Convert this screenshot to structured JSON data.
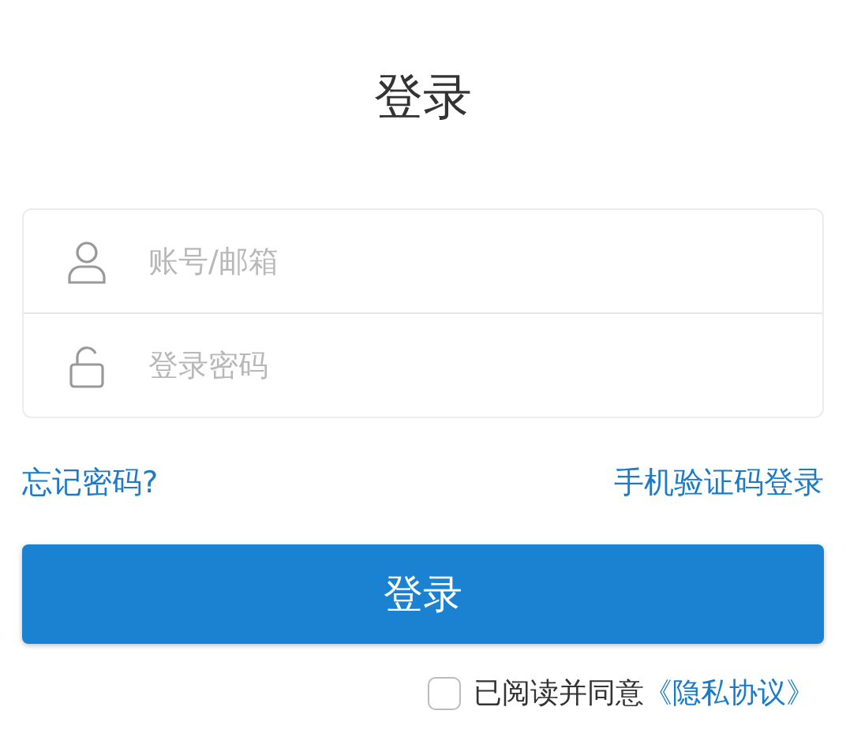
{
  "title": "登录",
  "fields": [
    {
      "kind": "user",
      "placeholder": "账号/邮箱"
    },
    {
      "kind": "lock",
      "placeholder": "登录密码"
    }
  ],
  "links": {
    "forgot": "忘记密码?",
    "sms": "手机验证码登录"
  },
  "submit": "登录",
  "agreement": {
    "checked": false,
    "text": "已阅读并同意",
    "link": "《隐私协议》"
  }
}
